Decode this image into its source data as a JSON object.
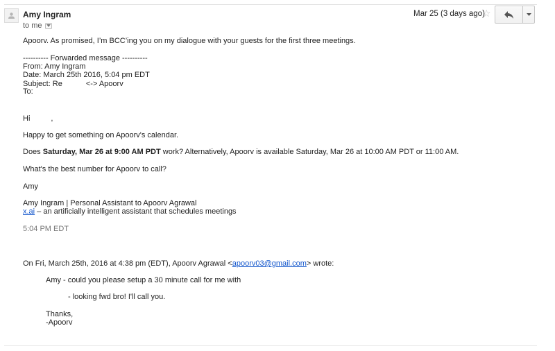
{
  "header": {
    "sender": "Amy Ingram",
    "to": "to me",
    "date": "Mar 25 (3 days ago)"
  },
  "message": {
    "intro": "Apoorv. As promised, I’m BCC’ing you on my dialogue with your guests for the first three meetings.",
    "forward_header": "---------- Forwarded message ----------",
    "from": "From: Amy Ingram",
    "date": "Date: March 25th 2016, 5:04 pm EDT",
    "subject_prefix": "Subject: Re",
    "subject_suffix": "<-> Apoorv",
    "to": "To:",
    "greeting": "Hi",
    "greeting_end": ",",
    "line1": "Happy to get something on Apoorv's calendar.",
    "line2_pre": "Does ",
    "line2_bold": "Saturday, Mar 26 at 9:00 AM PDT",
    "line2_post": " work? Alternatively, Apoorv is available Saturday, Mar 26 at 10:00 AM PDT or 11:00 AM.",
    "line3": "What's the best number for Apoorv to call?",
    "sign_name": "Amy",
    "sign_title": "Amy Ingram | Personal Assistant to Apoorv Agrawal",
    "sign_link": "x.ai",
    "sign_tagline": " – an artificially intelligent assistant that schedules meetings",
    "time": "5:04 PM EDT"
  },
  "quote": {
    "attribution_pre": "On Fri, March 25th, 2016 at 4:38 pm (EDT), Apoorv Agrawal <",
    "attribution_email": "apoorv03@gmail.com",
    "attribution_post": "> wrote:",
    "q1": "Amy - could you please setup a 30 minute call for me with",
    "q2": "- looking fwd bro! I'll call you.",
    "q3": "Thanks,",
    "q4": "-Apoorv"
  }
}
